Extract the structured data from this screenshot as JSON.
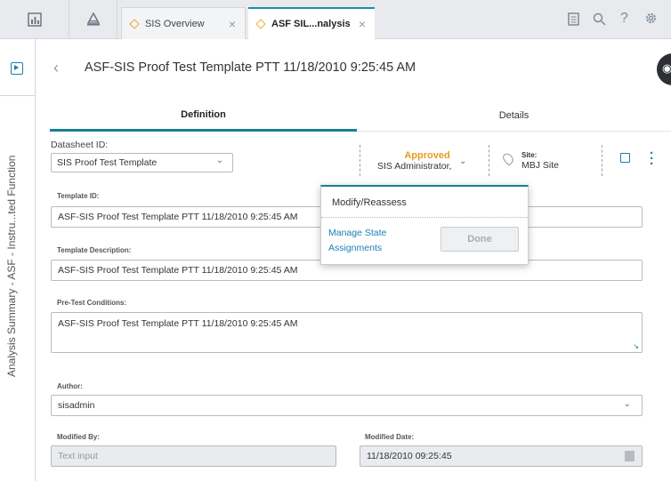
{
  "tabs": [
    {
      "label": "SIS Overview",
      "active": false
    },
    {
      "label": "ASF SIL...nalysis",
      "active": true
    }
  ],
  "icons": {
    "dashboard": "dashboard-icon",
    "home": "home-icon",
    "notes": "notes-icon",
    "search": "search-icon",
    "help": "help-icon",
    "settings": "gear-icon"
  },
  "rail": {
    "label": "Analysis Summary - ASF - Instru...ted Function"
  },
  "header": {
    "title": "ASF-SIS Proof Test Template PTT 11/18/2010 9:25:45 AM"
  },
  "subtabs": [
    {
      "label": "Definition",
      "active": true
    },
    {
      "label": "Details",
      "active": false
    }
  ],
  "datasheet": {
    "label": "Datasheet ID:",
    "value": "SIS Proof Test Template"
  },
  "state": {
    "status": "Approved",
    "status_color": "#e99a1d",
    "assignee": "SIS Administrator,"
  },
  "site": {
    "label": "Site:",
    "value": "MBJ Site"
  },
  "fields": {
    "template_id": {
      "label": "Template ID:",
      "value": "ASF-SIS Proof Test Template PTT 11/18/2010 9:25:45 AM"
    },
    "template_description": {
      "label": "Template Description:",
      "value": "ASF-SIS Proof Test Template PTT 11/18/2010 9:25:45 AM"
    },
    "pretest_conditions": {
      "label": "Pre-Test Conditions:",
      "value": "ASF-SIS Proof Test Template PTT 11/18/2010 9:25:45 AM"
    },
    "author": {
      "label": "Author:",
      "value": "sisadmin"
    },
    "modified_by": {
      "label": "Modified By:",
      "placeholder": "Text input"
    },
    "modified_date": {
      "label": "Modified Date:",
      "value": "11/18/2010 09:25:45"
    }
  },
  "popover": {
    "title": "Modify/Reassess",
    "link": "Manage State Assignments",
    "done_label": "Done"
  },
  "colors": {
    "accent": "#1a7f94",
    "link": "#1a7fb4"
  }
}
